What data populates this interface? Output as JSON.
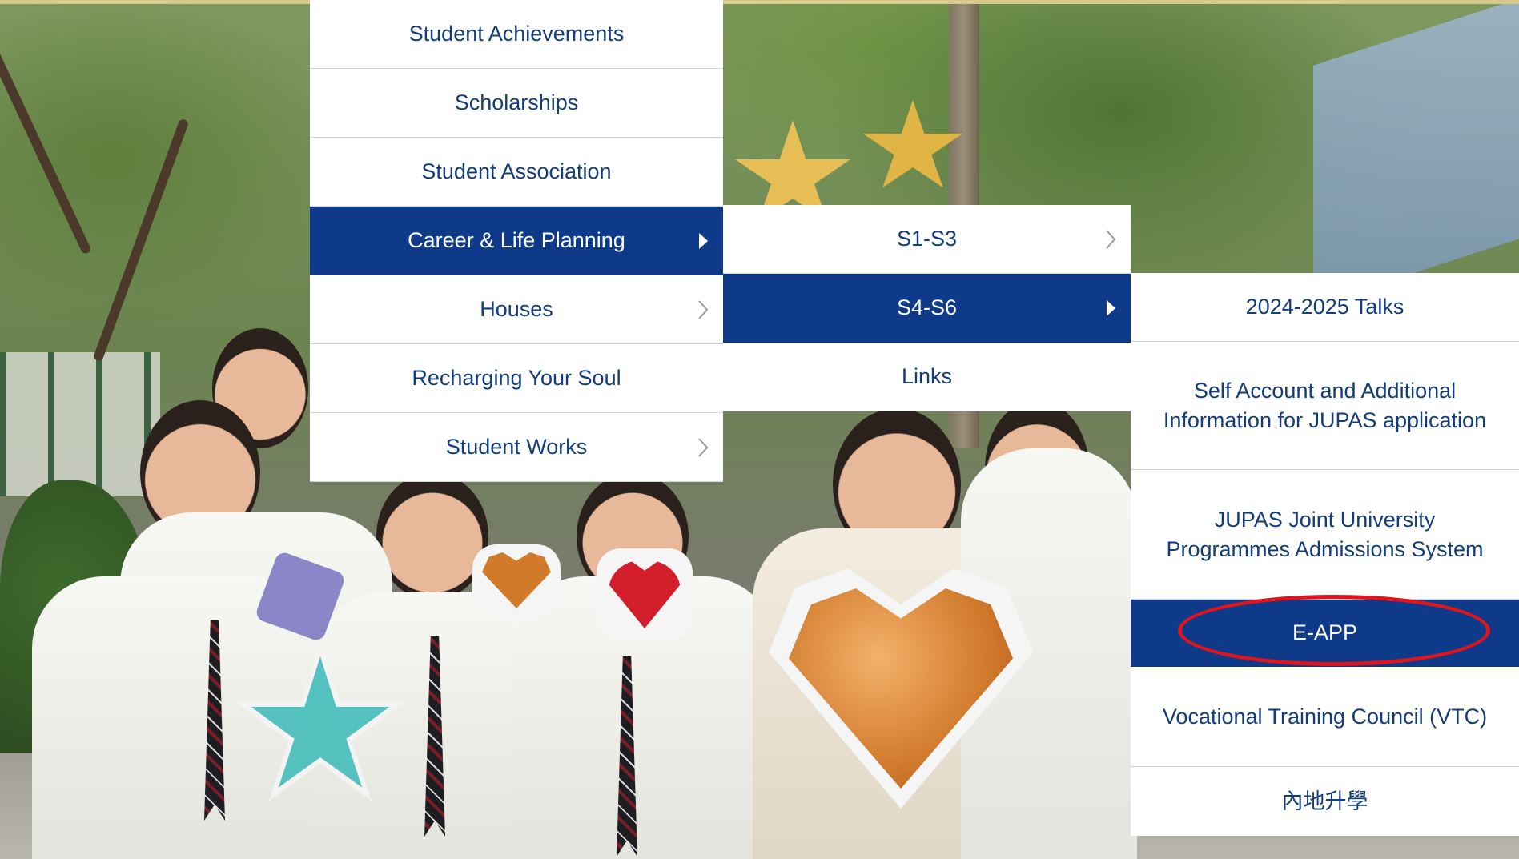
{
  "menu_level1": {
    "items": [
      {
        "label": "Student Achievements",
        "has_submenu": false,
        "active": false
      },
      {
        "label": "Scholarships",
        "has_submenu": false,
        "active": false
      },
      {
        "label": "Student Association",
        "has_submenu": false,
        "active": false
      },
      {
        "label": "Career & Life Planning",
        "has_submenu": true,
        "active": true
      },
      {
        "label": "Houses",
        "has_submenu": true,
        "active": false
      },
      {
        "label": "Recharging Your Soul",
        "has_submenu": false,
        "active": false
      },
      {
        "label": "Student Works",
        "has_submenu": true,
        "active": false
      }
    ]
  },
  "menu_level2": {
    "items": [
      {
        "label": "S1-S3",
        "has_submenu": true,
        "active": false
      },
      {
        "label": "S4-S6",
        "has_submenu": true,
        "active": true
      },
      {
        "label": "Links",
        "has_submenu": false,
        "active": false
      }
    ]
  },
  "menu_level3": {
    "items": [
      {
        "label": "2024-2025 Talks",
        "active": false
      },
      {
        "label": "Self Account and Additional Information for JUPAS application",
        "active": false
      },
      {
        "label": "JUPAS Joint University Programmes Admissions System",
        "active": false
      },
      {
        "label": "E-APP",
        "active": true,
        "circled": true
      },
      {
        "label": "Vocational Training Council (VTC)",
        "active": false
      },
      {
        "label": "內地升學",
        "active": false
      }
    ]
  },
  "colors": {
    "menu_active_bg": "#0f3a8a",
    "menu_text": "#123d7a",
    "highlight": "#e0141c"
  }
}
